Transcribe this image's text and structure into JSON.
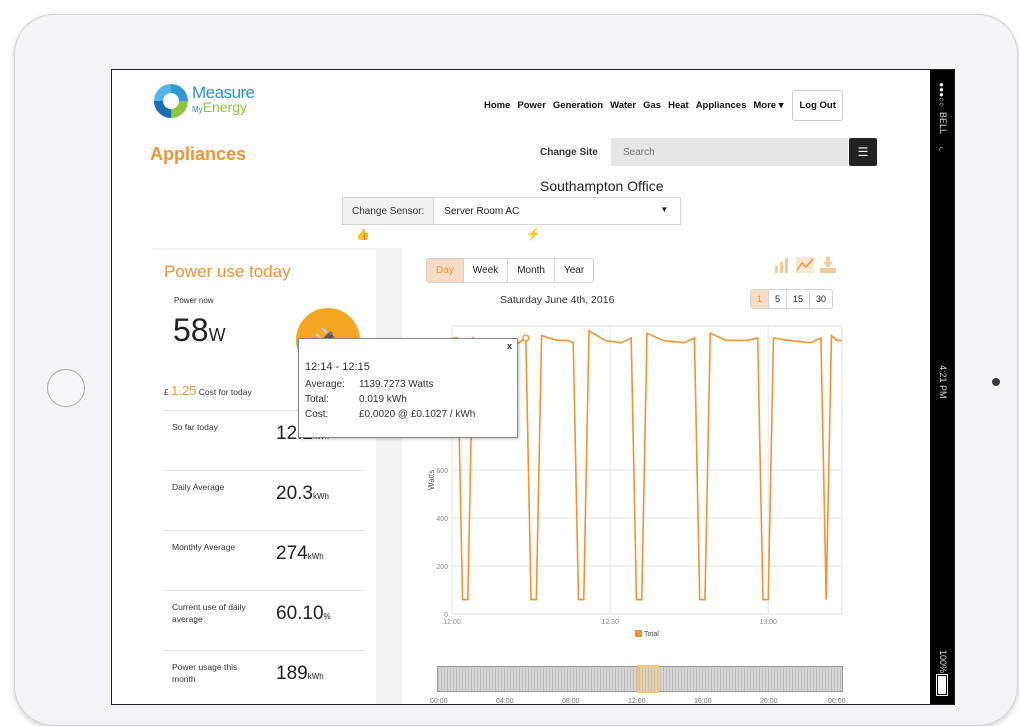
{
  "brand": {
    "line1": "Measure",
    "my": "My",
    "line2": "Energy"
  },
  "nav": {
    "items": [
      "Home",
      "Power",
      "Generation",
      "Water",
      "Gas",
      "Heat",
      "Appliances",
      "More ▾"
    ],
    "logout": "Log Out"
  },
  "page": {
    "title": "Appliances"
  },
  "site": {
    "label": "Change Site",
    "placeholder": "Search",
    "menu_icon": "☰",
    "name": "Southampton Office"
  },
  "sensor": {
    "label": "Change Sensor:",
    "value": "Server Room AC"
  },
  "status_bar": {
    "carrier": "BELL",
    "time": "4:21 PM",
    "battery": "100%"
  },
  "power_today": {
    "title": "Power use today",
    "now_label": "Power now",
    "now_value": "58",
    "now_unit": "W",
    "cost_currency": "£",
    "cost_value": "1.25",
    "cost_label": "Cost for today",
    "stats": [
      {
        "label": "So far today",
        "value": "12.2",
        "unit": "kWh"
      },
      {
        "label": "Daily Average",
        "value": "20.3",
        "unit": "kWh"
      },
      {
        "label": "Monthly Average",
        "value": "274",
        "unit": "kWh"
      },
      {
        "label": "Current use of daily average",
        "value": "60.10",
        "unit": "%"
      },
      {
        "label": "Power usage this month",
        "value": "189",
        "unit": "kWh"
      }
    ]
  },
  "chart": {
    "range_tabs": [
      "Day",
      "Week",
      "Month",
      "Year"
    ],
    "active_range": "Day",
    "date": "Saturday June 4th, 2016",
    "resolution_tabs": [
      "1",
      "5",
      "15",
      "30"
    ],
    "active_resolution": "1",
    "navigator_ticks": [
      "00:00",
      "04:00",
      "08:00",
      "12:00",
      "16:00",
      "20:00",
      "00:00"
    ],
    "navigator_window": {
      "start_fraction": 0.49,
      "end_fraction": 0.545
    },
    "accent": "#f09433"
  },
  "tooltip": {
    "close": "x",
    "range": "12:14 - 12:15",
    "average_label": "Average:",
    "average_value": "1139.7273 Watts",
    "total_label": "Total:",
    "total_value": "0.019 kWh",
    "cost_label": "Cost:",
    "cost_value": "£0.0020 @ £0.1027 / kWh"
  },
  "chart_data": {
    "type": "line",
    "title": "",
    "xlabel": "",
    "ylabel": "Watts",
    "x_ticks": [
      "12:00",
      "12:30",
      "13:00"
    ],
    "y_ticks": [
      0,
      200,
      400,
      600
    ],
    "ylim": [
      0,
      1200
    ],
    "xlim_minutes": [
      0,
      74
    ],
    "legend": [
      "Total"
    ],
    "grid": true,
    "series": [
      {
        "name": "Total",
        "color": "#f09433",
        "x_minutes": [
          0,
          1,
          2,
          3,
          4,
          5,
          8,
          12,
          14,
          15,
          16,
          17,
          20,
          22,
          23,
          24,
          25,
          26,
          29,
          32,
          34,
          35,
          36,
          37,
          40,
          44,
          46,
          47,
          48,
          49,
          52,
          56,
          58,
          59,
          60,
          61,
          64,
          68,
          70,
          71,
          72,
          73,
          74
        ],
        "values": [
          1150,
          1150,
          60,
          60,
          1150,
          1140,
          1120,
          1120,
          1150,
          60,
          60,
          1160,
          1140,
          1140,
          1130,
          60,
          60,
          1180,
          1140,
          1130,
          1150,
          60,
          60,
          1170,
          1140,
          1130,
          1150,
          60,
          60,
          1170,
          1140,
          1140,
          1150,
          60,
          60,
          1150,
          1140,
          1130,
          1150,
          60,
          1160,
          1140,
          1140
        ]
      }
    ]
  }
}
